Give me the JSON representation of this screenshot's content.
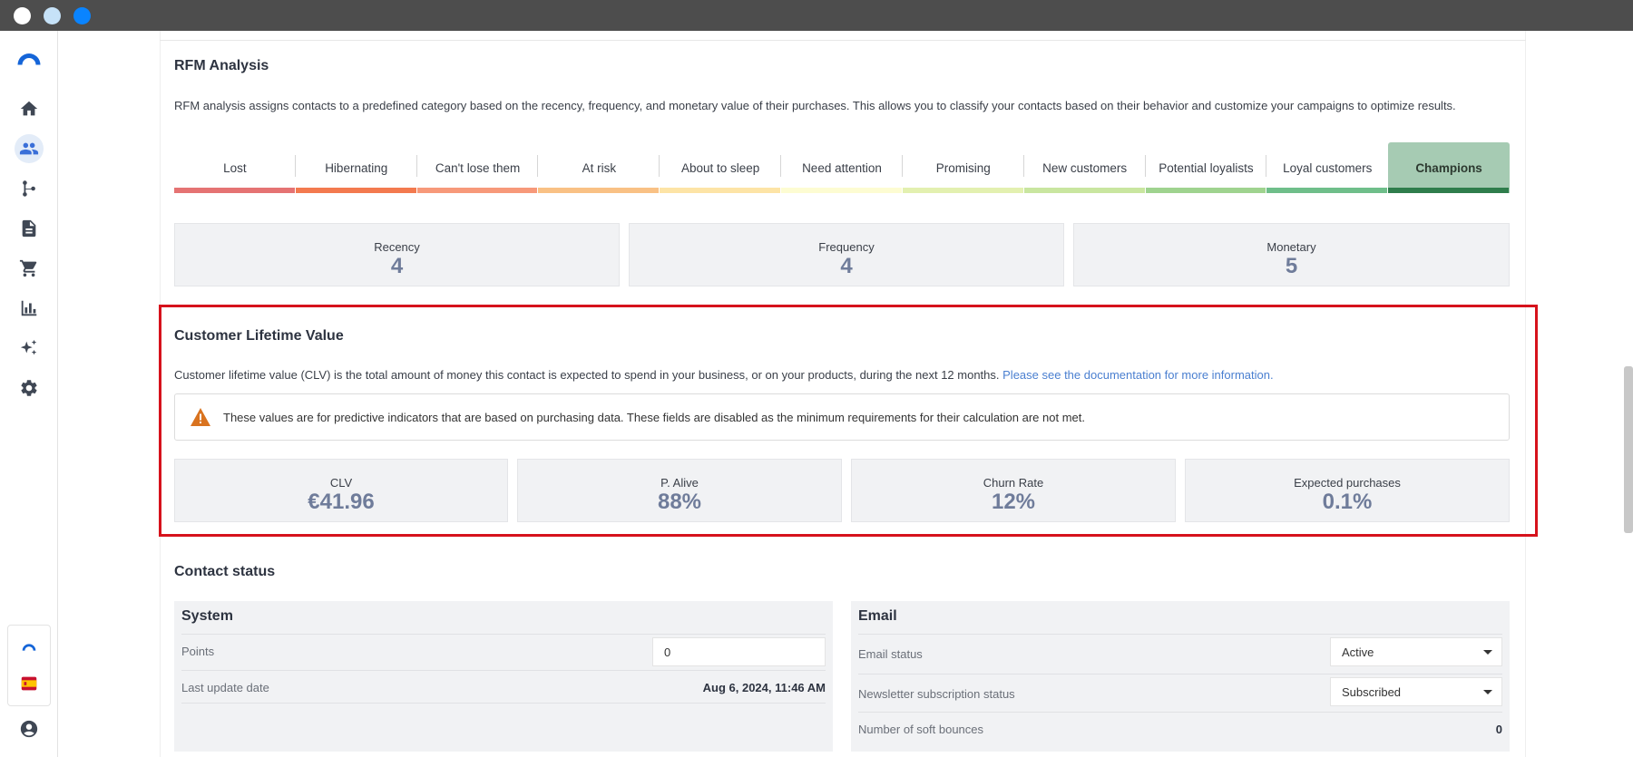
{
  "rfm": {
    "title": "RFM Analysis",
    "description": "RFM analysis assigns contacts to a predefined category based on the recency, frequency, and monetary value of their purchases. This allows you to classify your contacts based on their behavior and customize your campaigns to optimize results.",
    "segments": [
      {
        "label": "Lost",
        "color": "#e57373"
      },
      {
        "label": "Hibernating",
        "color": "#f37a4f"
      },
      {
        "label": "Can't lose them",
        "color": "#f7997a"
      },
      {
        "label": "At risk",
        "color": "#f9c185"
      },
      {
        "label": "About to sleep",
        "color": "#fde4a6"
      },
      {
        "label": "Need attention",
        "color": "#fdfcd2"
      },
      {
        "label": "Promising",
        "color": "#e3f0b0"
      },
      {
        "label": "New customers",
        "color": "#c9e6a0"
      },
      {
        "label": "Potential loyalists",
        "color": "#9fd38f"
      },
      {
        "label": "Loyal customers",
        "color": "#6fbe8a"
      },
      {
        "label": "Champions",
        "color": "#2f7d4c"
      }
    ],
    "selected_segment": "Champions",
    "scores": {
      "recency_label": "Recency",
      "recency_value": "4",
      "frequency_label": "Frequency",
      "frequency_value": "4",
      "monetary_label": "Monetary",
      "monetary_value": "5"
    }
  },
  "clv": {
    "title": "Customer Lifetime Value",
    "description": "Customer lifetime value (CLV) is the total amount of money this contact is expected to spend in your business, or on your products, during the next 12 months.",
    "doc_link": "Please see the documentation for more information.",
    "warning": "These values are for predictive indicators that are based on purchasing data. These fields are disabled as the minimum requirements for their calculation are not met.",
    "clv_label": "CLV",
    "clv_value": "€41.96",
    "palive_label": "P. Alive",
    "palive_value": "88%",
    "churn_label": "Churn Rate",
    "churn_value": "12%",
    "expected_label": "Expected purchases",
    "expected_value": "0.1%",
    "highlight_color": "#d6121c"
  },
  "contact_status": {
    "title": "Contact status",
    "system": {
      "title": "System",
      "points_label": "Points",
      "points_value": "0",
      "last_update_label": "Last update date",
      "last_update_value": "Aug 6, 2024, 11:46 AM"
    },
    "email": {
      "title": "Email",
      "email_status_label": "Email status",
      "email_status_value": "Active",
      "newsletter_label": "Newsletter subscription status",
      "newsletter_value": "Subscribed",
      "soft_bounces_label": "Number of soft bounces",
      "soft_bounces_value": "0"
    }
  },
  "sidebar": {
    "icons": [
      "logo-icon",
      "home-icon",
      "contacts-icon",
      "workflow-icon",
      "document-icon",
      "cart-icon",
      "chart-icon",
      "ai-sparkle-icon",
      "settings-icon"
    ],
    "active": "contacts-icon",
    "accent": "#3a6fd8"
  }
}
